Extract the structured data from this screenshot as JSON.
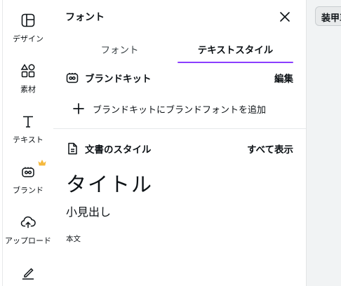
{
  "rail": {
    "items": [
      {
        "label": "デザイン",
        "icon": "layout-icon"
      },
      {
        "label": "素材",
        "icon": "elements-icon"
      },
      {
        "label": "テキスト",
        "icon": "text-icon"
      },
      {
        "label": "ブランド",
        "icon": "brand-icon"
      },
      {
        "label": "アップロード",
        "icon": "cloud-upload-icon"
      },
      {
        "label": "",
        "icon": "draw-icon"
      }
    ]
  },
  "panel": {
    "title": "フォント",
    "tabs": [
      {
        "label": "フォント",
        "active": false
      },
      {
        "label": "テキストスタイル",
        "active": true
      }
    ],
    "brand_kit": {
      "title": "ブランドキット",
      "edit_label": "編集",
      "add_label": "ブランドキットにブランドフォントを追加"
    },
    "doc_styles": {
      "title": "文書のスタイル",
      "see_all_label": "すべて表示",
      "heading": "タイトル",
      "subheading": "小見出し",
      "body": "本文"
    }
  },
  "canvas": {
    "button_label": "装甲車"
  },
  "colors": {
    "accent": "#8b3dff",
    "crown": "#f5b93e",
    "text": "#0d1216"
  }
}
